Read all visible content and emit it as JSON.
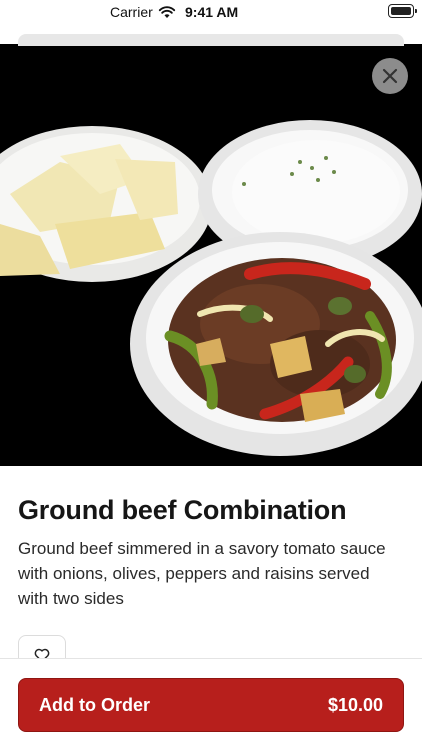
{
  "status_bar": {
    "carrier": "Carrier",
    "time": "9:41 AM"
  },
  "item": {
    "name": "Ground beef Combination",
    "description": "Ground beef simmered in a savory tomato sauce with onions, olives, peppers and raisins served with two sides"
  },
  "actions": {
    "add_label": "Add to Order",
    "price": "$10.00"
  },
  "colors": {
    "accent": "#b71f1c",
    "hero_background": "#000000"
  },
  "icons": {
    "close": "close-icon",
    "favorite": "heart-icon",
    "wifi": "wifi-icon",
    "battery": "battery-icon"
  }
}
